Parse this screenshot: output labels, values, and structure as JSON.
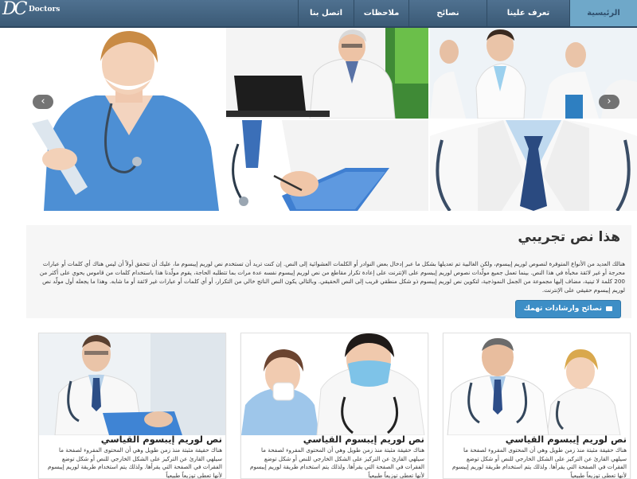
{
  "brand": {
    "logo_mark": "DC",
    "logo_text": "Doctors"
  },
  "nav": {
    "items": [
      {
        "label": "الرئيسية",
        "active": true
      },
      {
        "label": "تعرف علينا",
        "active": false
      },
      {
        "label": "نصائح",
        "active": false
      },
      {
        "label": "ملاحظات",
        "active": false
      },
      {
        "label": "اتصل بنا",
        "active": false
      }
    ]
  },
  "slider": {
    "prev_icon": "‹",
    "next_icon": "›"
  },
  "intro": {
    "title": "هذا نص تجريبي",
    "body": "هنالك العديد من الأنواع المتوفرة لنصوص لوريم إيبسوم، ولكن الغالبية تم تعديلها بشكل ما عبر إدخال بعض النوادر أو الكلمات العشوائية إلى النص. إن كنت تريد أن تستخدم نص لوريم إيبسوم ما، عليك أن تتحقق أولاً أن ليس هناك أي كلمات أو عبارات محرجة أو غير لائقة مخبأة في هذا النص. بينما تعمل جميع مولّدات نصوص لوريم إيبسوم على الإنترنت على إعادة تكرار مقاطع من نص لوريم إيبسوم نفسه عدة مرات بما تتطلبه الحاجة، يقوم مولّدنا هذا باستخدام كلمات من قاموس يحوي على أكثر من 200 كلمة لا تينية، مضاف إليها مجموعة من الجمل النموذجية، لتكوين نص لوريم إيبسوم ذو شكل منطقي قريب إلى النص الحقيقي. وبالتالي يكون النص الناتج خالي من التكرار، أو أي كلمات أو عبارات غير لائقة أو ما شابه. وهذا ما يجعله أول مولّد نص لوريم إيبسوم حقيقي على الإنترنت.",
    "cta_label": "نصائح وارشادات تهمك",
    "cta_icon": "message-icon"
  },
  "cards": [
    {
      "title": "نص لوريم إيبسوم القياسي",
      "body": "هناك حقيقة مثبتة منذ زمن طويل وهي أن المحتوى المقروء لصفحة ما سيلهي القارئ عن التركيز على الشكل الخارجي للنص أو شكل توضع الفقرات في الصفحة التي يقرأها. ولذلك يتم استخدام طريقة لوريم إيبسوم لأنها تعطي توزيعاً طبيعياً"
    },
    {
      "title": "نص لوريم إيبسوم القياسي",
      "body": "هناك حقيقة مثبتة منذ زمن طويل وهي أن المحتوى المقروء لصفحة ما سيلهي القارئ عن التركيز على الشكل الخارجي للنص أو شكل توضع الفقرات في الصفحة التي يقرأها. ولذلك يتم استخدام طريقة لوريم إيبسوم لأنها تعطي توزيعاً طبيعياً"
    },
    {
      "title": "نص لوريم إيبسوم القياسي",
      "body": "هناك حقيقة مثبتة منذ زمن طويل وهي أن المحتوى المقروء لصفحة ما سيلهي القارئ عن التركيز على الشكل الخارجي للنص أو شكل توضع الفقرات في الصفحة التي يقرأها. ولذلك يتم استخدام طريقة لوريم إيبسوم لأنها تعطي توزيعاً طبيعياً"
    }
  ],
  "colors": {
    "nav_bg": "#46668a",
    "nav_active": "#6fa8c9",
    "cta": "#3d8ec6",
    "intro_bg": "#f6f6f6"
  }
}
